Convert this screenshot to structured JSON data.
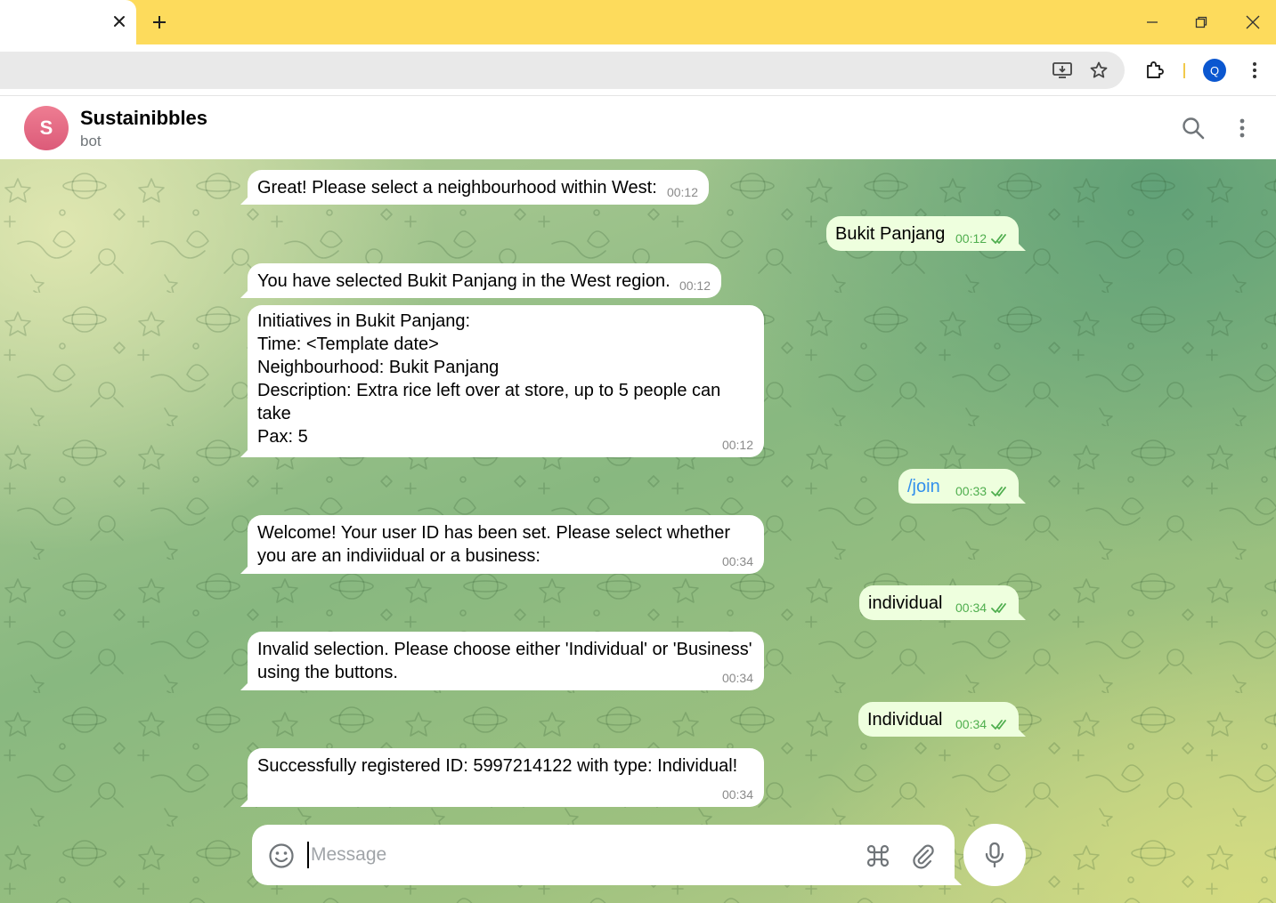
{
  "browser": {
    "tab_close_icon": "close-icon",
    "new_tab_icon": "plus-icon",
    "window_controls": [
      "minimize-icon",
      "restore-icon",
      "close-icon"
    ],
    "toolbar_icons": [
      "install-app-icon",
      "bookmark-star-icon",
      "extensions-icon",
      "menu-dots-icon"
    ],
    "profile_initial": "Q",
    "accent_color": "#fddb5c",
    "profile_color": "#0b57d0"
  },
  "chat": {
    "name": "Sustainibbles",
    "status": "bot",
    "avatar_letter": "S",
    "icons": [
      "search-icon",
      "more-vertical-icon"
    ]
  },
  "messages": [
    {
      "direction": "incoming",
      "text": "Great! Please select a neighbourhood within West:",
      "time": "00:12"
    },
    {
      "direction": "outgoing",
      "text": "Bukit Panjang",
      "time": "00:12",
      "read": true
    },
    {
      "direction": "incoming",
      "text": "You have selected Bukit Panjang in the West region.",
      "time": "00:12"
    },
    {
      "direction": "incoming",
      "text": "Initiatives in Bukit Panjang:\nTime: <Template date>\nNeighbourhood: Bukit Panjang\nDescription: Extra rice left over at store, up to 5 people can take\nPax: 5",
      "time": "00:12"
    },
    {
      "direction": "outgoing",
      "text": "/join",
      "time": "00:33",
      "read": true
    },
    {
      "direction": "incoming",
      "text": "Welcome! Your user ID has been set. Please select whether you are an indiviidual or a business:",
      "time": "00:34"
    },
    {
      "direction": "outgoing",
      "text": "individual",
      "time": "00:34",
      "read": true
    },
    {
      "direction": "incoming",
      "text": "Invalid selection. Please choose either 'Individual' or 'Business' using the buttons.",
      "time": "00:34"
    },
    {
      "direction": "outgoing",
      "text": "Individual",
      "time": "00:34",
      "read": true
    },
    {
      "direction": "incoming",
      "text": "Successfully registered ID: 5997214122 with type: Individual!",
      "time": "00:34"
    }
  ],
  "composer": {
    "placeholder": "Message",
    "icons": [
      "emoji-icon",
      "bot-commands-icon",
      "attachment-icon",
      "microphone-icon"
    ]
  }
}
